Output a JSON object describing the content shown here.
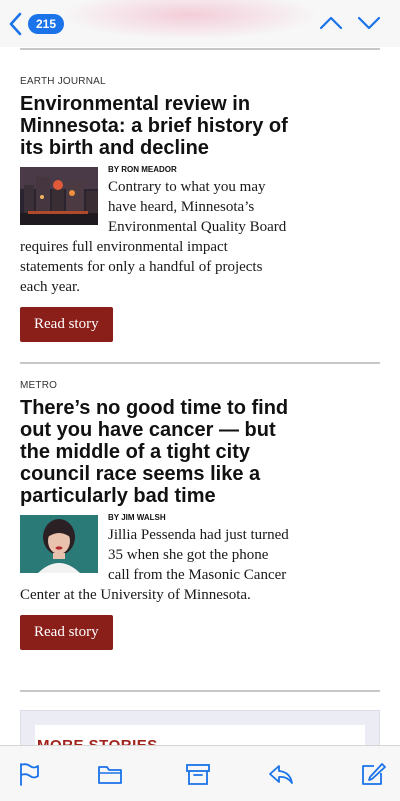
{
  "nav": {
    "unread_count": "215",
    "accent": "#1a73e8"
  },
  "articles": [
    {
      "kicker": "EARTH JOURNAL",
      "headline": "Environmental review in Minnesota: a brief history of its birth and decline",
      "byline": "BY RON MEADOR",
      "excerpt": "Contrary to what you may have heard, Minnesota’s Environmental Quality Board requires full environmental impact statements for only a handful of projects each year.",
      "button": "Read story"
    },
    {
      "kicker": "METRO",
      "headline": "There’s no good time to find out you have cancer — but the middle of a tight city council race seems like a particularly bad time",
      "byline": "BY JIM WALSH",
      "excerpt": "Jillia Pessenda had just turned 35 when she got the phone call from the Masonic Cancer Center at the University of Minnesota.",
      "button": "Read story"
    }
  ],
  "more": {
    "label": "MORE STORIES"
  },
  "colors": {
    "button_bg": "#8a1f1a",
    "more_label": "#a0221b",
    "icon": "#1a73e8"
  },
  "toolbar": {
    "icons": [
      "flag-icon",
      "folder-icon",
      "archive-icon",
      "reply-icon",
      "compose-icon"
    ]
  }
}
